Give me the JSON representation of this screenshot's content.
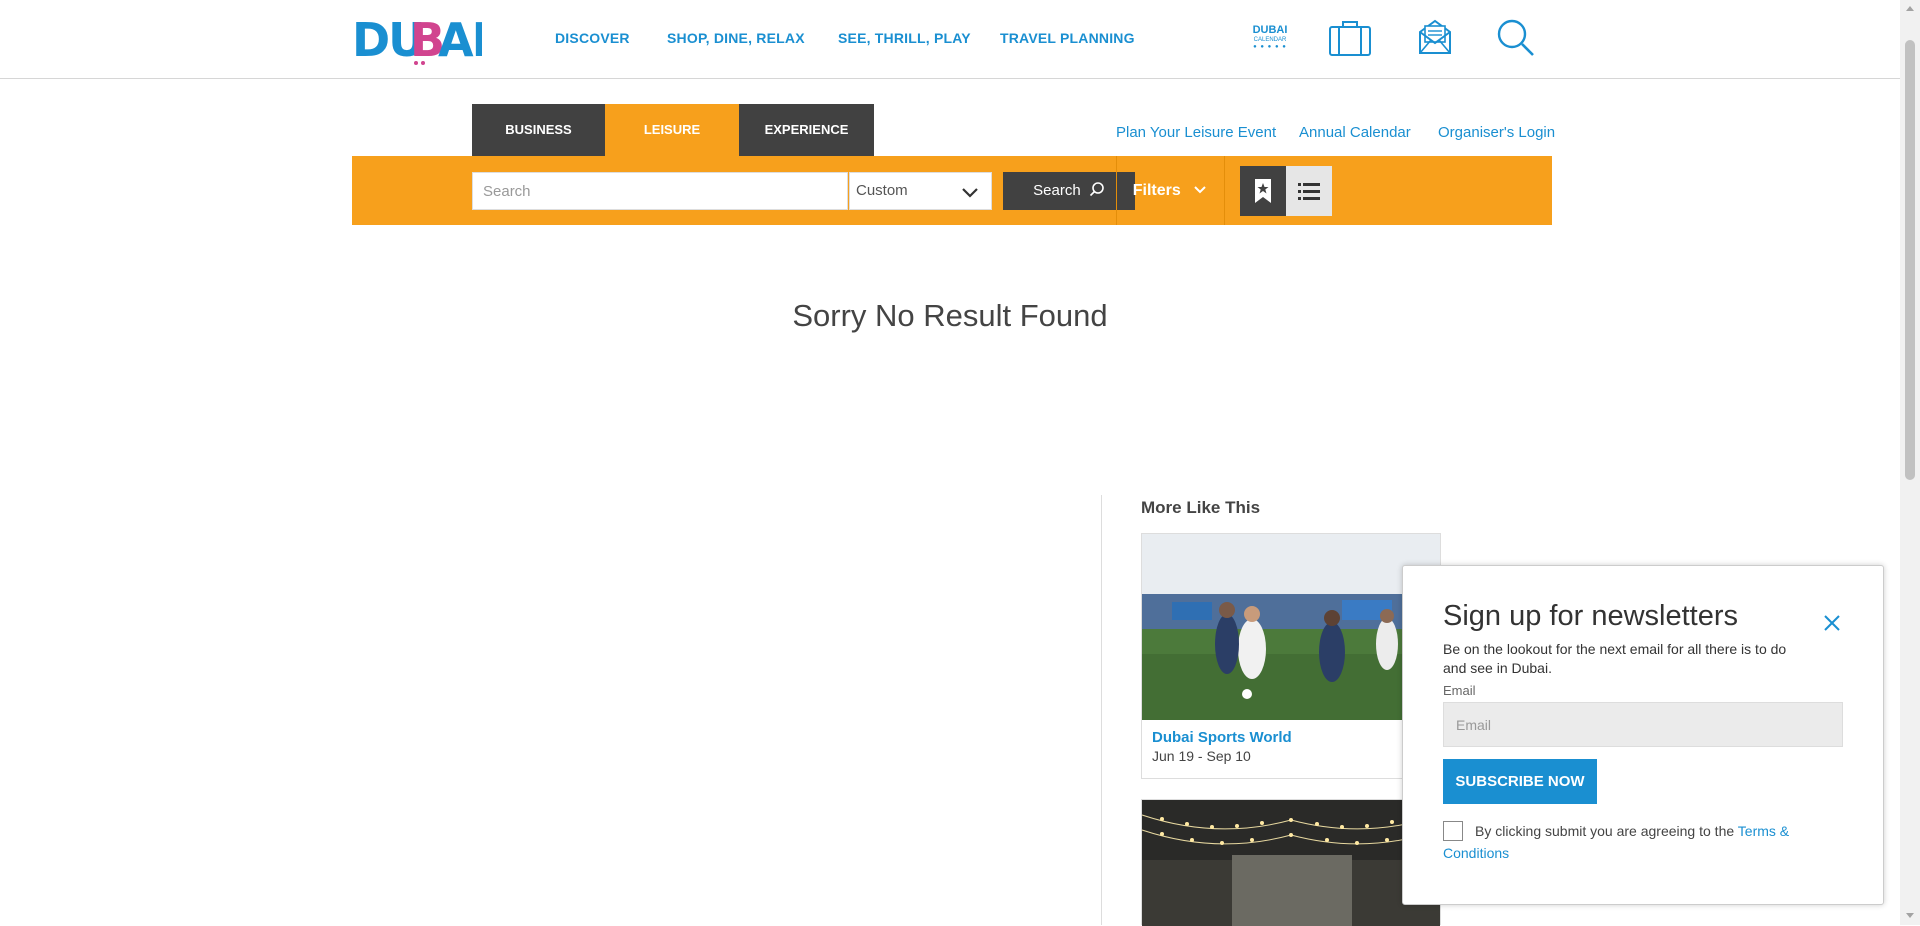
{
  "header": {
    "logo_text": "DUBAI",
    "nav": [
      "DISCOVER",
      "SHOP, DINE, RELAX",
      "SEE, THRILL, PLAY",
      "TRAVEL PLANNING"
    ],
    "calendar_badge": {
      "line1": "DUBAI",
      "line2": "CALENDAR",
      "dots": "● ● ● ● ●"
    }
  },
  "tabs": [
    "BUSINESS",
    "LEISURE",
    "EXPERIENCE"
  ],
  "active_tab": "LEISURE",
  "top_links": [
    "Plan Your Leisure Event",
    "Annual Calendar",
    "Organiser's Login"
  ],
  "search_bar": {
    "placeholder": "Search",
    "date_select": "Custom",
    "search_button": "Search",
    "filters_label": "Filters"
  },
  "main": {
    "no_result_text": "Sorry No Result Found"
  },
  "more_like_this": {
    "heading": "More Like This",
    "cards": [
      {
        "title": "Dubai Sports World",
        "date": "Jun 19 - Sep 10"
      },
      {
        "title": "",
        "date": ""
      }
    ]
  },
  "newsletter": {
    "title": "Sign up for newsletters",
    "description": "Be on the lookout for the next email for all there is to do and see in Dubai.",
    "email_label": "Email",
    "email_placeholder": "Email",
    "subscribe_button": "SUBSCRIBE NOW",
    "terms_text": "By clicking submit you are agreeing to the",
    "terms_link": "Terms & Conditions"
  },
  "colors": {
    "accent_orange": "#f7a01c",
    "brand_blue": "#1a8fd1",
    "dark_tab": "#414141"
  },
  "icons": [
    "calendar-badge-icon",
    "suitcase-icon",
    "newsletter-envelope-icon",
    "search-icon",
    "bookmark-icon",
    "list-view-icon",
    "close-icon",
    "chevron-down-icon"
  ]
}
